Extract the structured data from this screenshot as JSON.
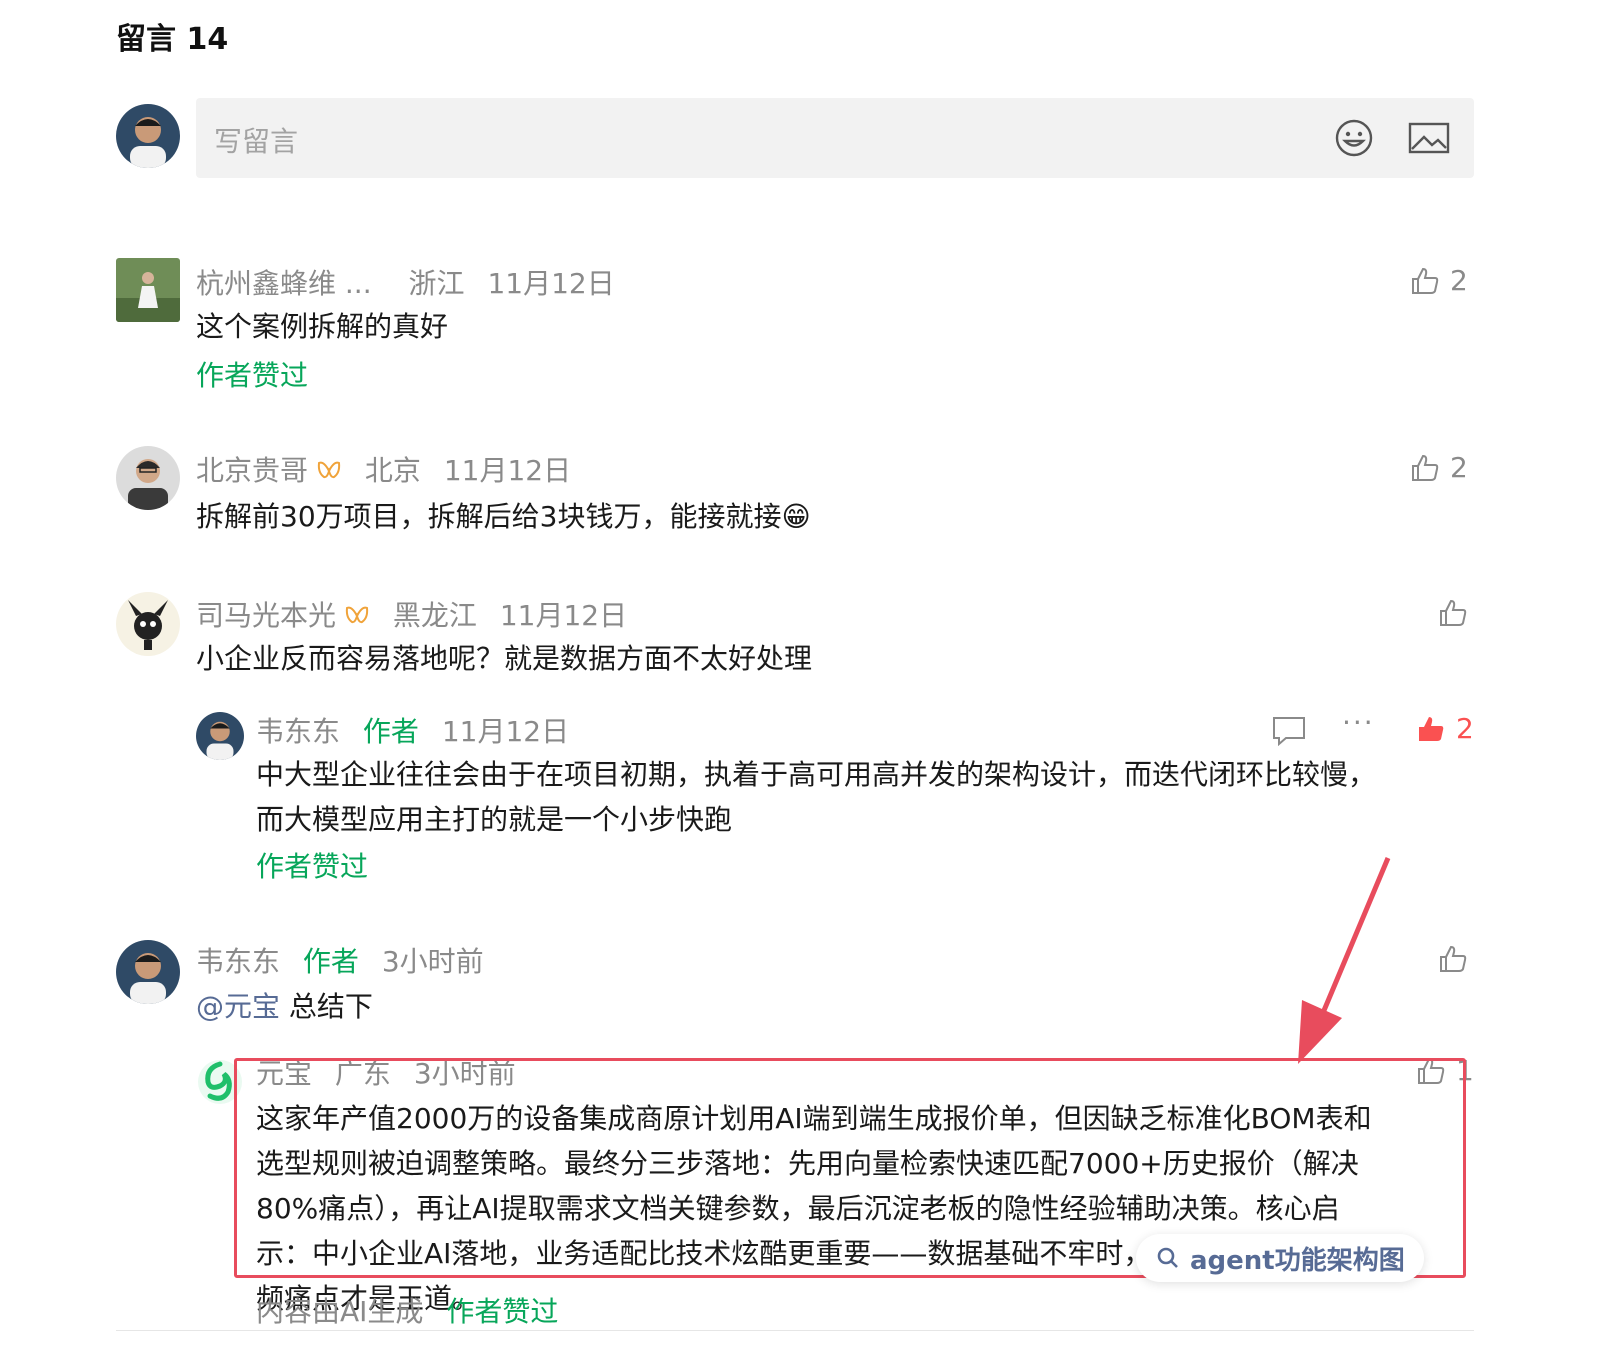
{
  "heading": "留言 14",
  "compose": {
    "placeholder": "写留言"
  },
  "colors": {
    "author_green": "#07a65a",
    "meta_gray": "#8a8a8a",
    "like_red": "#fa5151",
    "mention_blue": "#576b95",
    "highlight_red": "#e84c5d"
  },
  "comments": [
    {
      "name": "杭州鑫蜂维 ...",
      "location": "浙江",
      "date": "11月12日",
      "text": "这个案例拆解的真好",
      "likes": "2",
      "author_liked": "作者赞过"
    },
    {
      "name": "北京贵哥",
      "location": "北京",
      "date": "11月12日",
      "text": "拆解前30万项目，拆解后给3块钱万，能接就接😁",
      "likes": "2"
    },
    {
      "name": "司马光本光",
      "location": "黑龙江",
      "date": "11月12日",
      "text": "小企业反而容易落地呢？就是数据方面不太好处理",
      "reply": {
        "name": "韦东东",
        "tag": "作者",
        "date": "11月12日",
        "text_line1": "中大型企业往往会由于在项目初期，执着于高可用高并发的架构设计，而迭代闭环比较慢，",
        "text_line2": "而大模型应用主打的就是一个小步快跑",
        "likes": "2",
        "more": "···",
        "author_liked": "作者赞过"
      }
    },
    {
      "name": "韦东东",
      "tag": "作者",
      "date": "3小时前",
      "mention": "@元宝",
      "text": "总结下",
      "reply": {
        "name": "元宝",
        "location": "广东",
        "date": "3小时前",
        "likes": "1",
        "lines": [
          "这家年产值2000万的设备集成商原计划用AI端到端生成报价单，但因缺乏标准化BOM表和",
          "选型规则被迫调整策略。最终分三步落地：先用向量检索快速匹配7000+历史报价（解决",
          "80%痛点），再让AI提取需求文档关键参数，最后沉淀老板的隐性经验辅助决策。核心启",
          "示：中小企业AI落地，业务适配比技术炫酷更重要——数据基础不牢时，轻量级工具解决高",
          "频痛点才是王道。"
        ],
        "ai_note": "内容由AI生成",
        "author_liked": "作者赞过"
      }
    }
  ],
  "search_chip": {
    "label": "agent功能架构图"
  }
}
